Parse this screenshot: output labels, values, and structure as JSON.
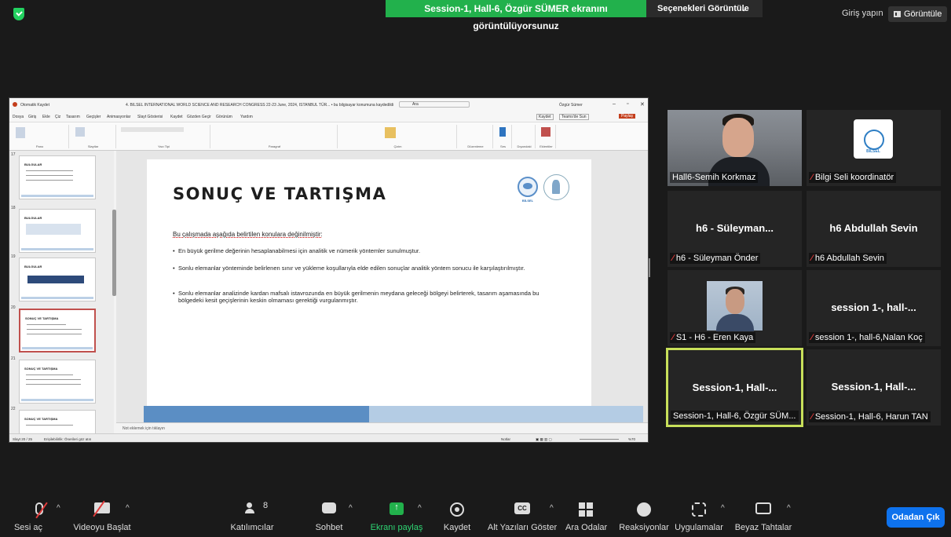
{
  "top": {
    "share_banner": "Session-1, Hall-6, Özgür SÜMER ekranını görüntülüyorsunuz",
    "view_options": "Seçenekleri Görüntüle",
    "signin": "Giriş yapın",
    "view_button": "Görüntüle"
  },
  "ppt": {
    "autosave": "Otomatik Kaydet",
    "doc_title": "4. BILSEL INTERNATIONAL WORLD SCIENCE AND RESEARCH CONGRESS 22-23 June, 2024, ISTANBUL TÜR... • bu bilgisayar konumuna kaydedildi",
    "search": "Ara",
    "user": "Özgür Sümer",
    "menu": [
      "Dosya",
      "Giriş",
      "Ekle",
      "Çiz",
      "Tasarım",
      "Geçişler",
      "Animasyonlar",
      "Slayt Gösterisi",
      "Kaydet",
      "Gözden Geçir",
      "Görünüm",
      "Yardım"
    ],
    "kaydet_btn": "Kaydet",
    "teams_btn": "Teams'de Sun",
    "share_btn": "Paylaş",
    "ribbon_groups": [
      "Pano",
      "Slaytlar",
      "Yazı Tipi",
      "Paragraf",
      "Çizim",
      "Düzenleme",
      "Ses",
      "Dışarıdaki",
      "Eklentiler"
    ],
    "thumbs": [
      {
        "num": "17",
        "title": "BULGULAR"
      },
      {
        "num": "18",
        "title": "BULGULAR"
      },
      {
        "num": "19",
        "title": "BULGULAR"
      },
      {
        "num": "20",
        "title": "SONUÇ VE TARTIŞMA"
      },
      {
        "num": "21",
        "title": "SONUÇ VE TARTIŞMA"
      },
      {
        "num": "22",
        "title": "SONUÇ VE TARTIŞMA"
      }
    ],
    "slide": {
      "title": "SONUÇ VE TARTIŞMA",
      "logo_text": "BİLSEL",
      "intro": "Bu çalışmada aşağıda belirtilen konulara değinilmiştir:",
      "bullets": [
        "En büyük gerilme değerinin hesaplanabilmesi için analitik ve nümerik yöntemler sunulmuştur.",
        "Sonlu elemanlar yönteminde belirlenen sınır ve yükleme koşullarıyla elde edilen sonuçlar analitik yöntem sonucu ile karşılaştırılmıştır.",
        "Sonlu elemanlar analizinde kardan mafsalı istavrozunda en büyük gerilmenin meydana geleceği bölgeyi belirterek, tasarım aşamasında bu bölgedeki kesit geçişlerinin keskin olmaması gerektiği vurgulanmıştır."
      ]
    },
    "notes": "Not eklemek için tıklayın",
    "status_slide": "Slayt 20 / 25",
    "status_access": "Erişilebilirlik: Önerileri göz atın",
    "status_notes": "Notlar",
    "zoom": "%70"
  },
  "participants": [
    {
      "label": "",
      "name": "Hall6-Semih Korkmaz",
      "muted": false
    },
    {
      "label": "",
      "name": "Bilgi Seli koordinatör",
      "muted": true,
      "logo_text": "BİLSEL"
    },
    {
      "label": "h6  - Süleyman...",
      "name": "h6 - Süleyman Önder",
      "muted": true
    },
    {
      "label": "h6 Abdullah Sevin",
      "name": "h6 Abdullah Sevin",
      "muted": true
    },
    {
      "label": "",
      "name": "S1 - H6 - Eren Kaya",
      "muted": true
    },
    {
      "label": "session 1-, hall-...",
      "name": "session 1-, hall-6,Nalan Koç",
      "muted": true
    },
    {
      "label": "Session-1,  Hall-...",
      "name": "Session-1, Hall-6, Özgür SÜM...",
      "muted": false
    },
    {
      "label": "Session-1,  Hall-...",
      "name": "Session-1, Hall-6, Harun TAN",
      "muted": true
    }
  ],
  "toolbar": {
    "unmute": "Sesi aç",
    "start_video": "Videoyu Başlat",
    "participants": "Katılımcılar",
    "participant_count": "8",
    "chat": "Sohbet",
    "share": "Ekranı paylaş",
    "record": "Kaydet",
    "captions": "Alt Yazıları Göster",
    "cc": "CC",
    "breakout": "Ara Odalar",
    "reactions": "Reaksiyonlar",
    "apps": "Uygulamalar",
    "whiteboard": "Beyaz Tahtalar",
    "leave": "Odadan Çık"
  },
  "colors": {
    "share_green": "#22b14c",
    "leave_blue": "#0e72ed",
    "active_speaker": "#c8e05a",
    "mute_red": "#e03b3b"
  }
}
